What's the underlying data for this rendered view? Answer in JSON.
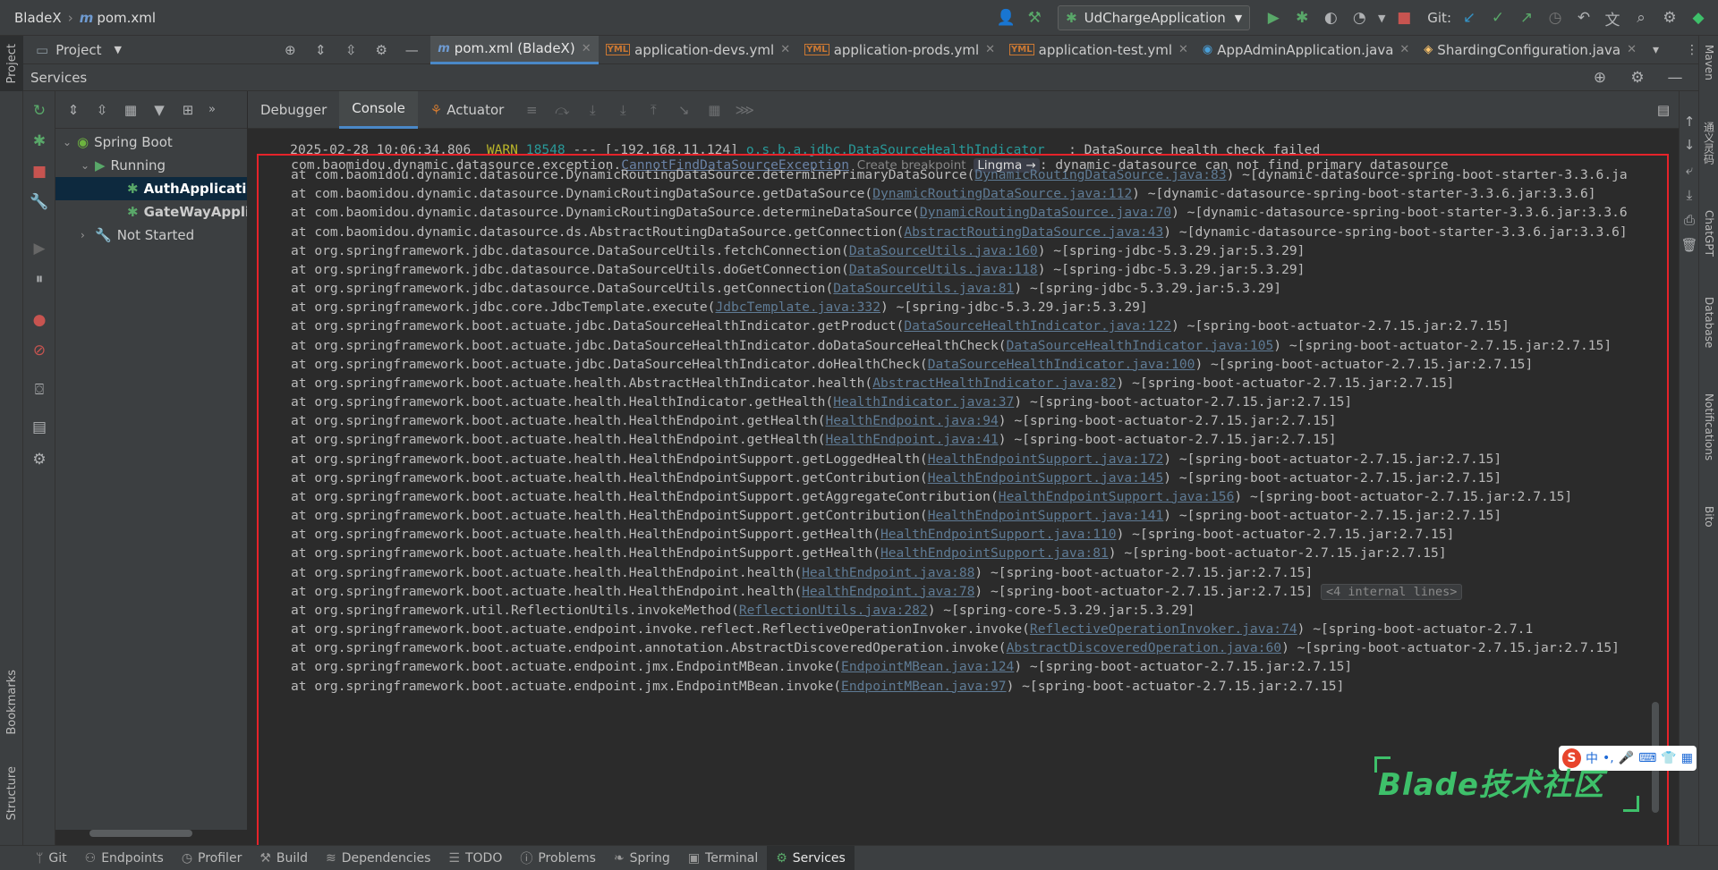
{
  "breadcrumb": {
    "project": "BladeX",
    "file": "pom.xml"
  },
  "toolbar": {
    "run_config": "UdChargeApplication",
    "git_label": "Git:"
  },
  "project_panel": {
    "label": "Project"
  },
  "editor_tabs": [
    {
      "label": "pom.xml (BladeX)",
      "icon": "m",
      "active": true
    },
    {
      "label": "application-devs.yml",
      "icon": "yml"
    },
    {
      "label": "application-prods.yml",
      "icon": "yml"
    },
    {
      "label": "application-test.yml",
      "icon": "yml"
    },
    {
      "label": "AppAdminApplication.java",
      "icon": "java"
    },
    {
      "label": "ShardingConfiguration.java",
      "icon": "java"
    }
  ],
  "services": {
    "title": "Services",
    "tree": {
      "root": "Spring Boot",
      "running": "Running",
      "apps": [
        "AuthApplication",
        "GateWayApplication"
      ],
      "not_started": "Not Started"
    },
    "console_tabs": [
      "Debugger",
      "Console",
      "Actuator"
    ]
  },
  "left_strip": {
    "project": "Project",
    "bookmarks": "Bookmarks",
    "structure": "Structure"
  },
  "right_strip": {
    "maven": "Maven",
    "tongyi": "通义灵码",
    "chatgpt": "ChatGPT",
    "database": "Database",
    "notifications": "Notifications",
    "bito": "Bito"
  },
  "console": {
    "warn_line": {
      "timestamp": "2025-02-28 10:06:34.806",
      "level": "WARN",
      "pid": "18548",
      "sep": "---",
      "thread": "[-192.168.11.124]",
      "logger": "o.s.b.a.jdbc.DataSourceHealthIndicator",
      "message": ": DataSource health check failed"
    },
    "exception": {
      "pkg": "com.baomidou.dynamic.datasource.exception.",
      "cls": "CannotFindDataSourceException",
      "hint": "Create breakpoint",
      "lingma": "Lingma →",
      "message": ": dynamic-datasource can not find primary datasource"
    },
    "frames": [
      {
        "method": "com.baomidou.dynamic.datasource.DynamicRoutingDataSource.determinePrimaryDataSource",
        "src": "DynamicRoutingDataSource.java:83",
        "jar": "~[dynamic-datasource-spring-boot-starter-3.3.6.ja"
      },
      {
        "method": "com.baomidou.dynamic.datasource.DynamicRoutingDataSource.getDataSource",
        "src": "DynamicRoutingDataSource.java:112",
        "jar": "~[dynamic-datasource-spring-boot-starter-3.3.6.jar:3.3.6]"
      },
      {
        "method": "com.baomidou.dynamic.datasource.DynamicRoutingDataSource.determineDataSource",
        "src": "DynamicRoutingDataSource.java:70",
        "jar": "~[dynamic-datasource-spring-boot-starter-3.3.6.jar:3.3.6"
      },
      {
        "method": "com.baomidou.dynamic.datasource.ds.AbstractRoutingDataSource.getConnection",
        "src": "AbstractRoutingDataSource.java:43",
        "jar": "~[dynamic-datasource-spring-boot-starter-3.3.6.jar:3.3.6]"
      },
      {
        "method": "org.springframework.jdbc.datasource.DataSourceUtils.fetchConnection",
        "src": "DataSourceUtils.java:160",
        "jar": "~[spring-jdbc-5.3.29.jar:5.3.29]"
      },
      {
        "method": "org.springframework.jdbc.datasource.DataSourceUtils.doGetConnection",
        "src": "DataSourceUtils.java:118",
        "jar": "~[spring-jdbc-5.3.29.jar:5.3.29]"
      },
      {
        "method": "org.springframework.jdbc.datasource.DataSourceUtils.getConnection",
        "src": "DataSourceUtils.java:81",
        "jar": "~[spring-jdbc-5.3.29.jar:5.3.29]"
      },
      {
        "method": "org.springframework.jdbc.core.JdbcTemplate.execute",
        "src": "JdbcTemplate.java:332",
        "jar": "~[spring-jdbc-5.3.29.jar:5.3.29]"
      },
      {
        "method": "org.springframework.boot.actuate.jdbc.DataSourceHealthIndicator.getProduct",
        "src": "DataSourceHealthIndicator.java:122",
        "jar": "~[spring-boot-actuator-2.7.15.jar:2.7.15]"
      },
      {
        "method": "org.springframework.boot.actuate.jdbc.DataSourceHealthIndicator.doDataSourceHealthCheck",
        "src": "DataSourceHealthIndicator.java:105",
        "jar": "~[spring-boot-actuator-2.7.15.jar:2.7.15]"
      },
      {
        "method": "org.springframework.boot.actuate.jdbc.DataSourceHealthIndicator.doHealthCheck",
        "src": "DataSourceHealthIndicator.java:100",
        "jar": "~[spring-boot-actuator-2.7.15.jar:2.7.15]"
      },
      {
        "method": "org.springframework.boot.actuate.health.AbstractHealthIndicator.health",
        "src": "AbstractHealthIndicator.java:82",
        "jar": "~[spring-boot-actuator-2.7.15.jar:2.7.15]"
      },
      {
        "method": "org.springframework.boot.actuate.health.HealthIndicator.getHealth",
        "src": "HealthIndicator.java:37",
        "jar": "~[spring-boot-actuator-2.7.15.jar:2.7.15]"
      },
      {
        "method": "org.springframework.boot.actuate.health.HealthEndpoint.getHealth",
        "src": "HealthEndpoint.java:94",
        "jar": "~[spring-boot-actuator-2.7.15.jar:2.7.15]"
      },
      {
        "method": "org.springframework.boot.actuate.health.HealthEndpoint.getHealth",
        "src": "HealthEndpoint.java:41",
        "jar": "~[spring-boot-actuator-2.7.15.jar:2.7.15]"
      },
      {
        "method": "org.springframework.boot.actuate.health.HealthEndpointSupport.getLoggedHealth",
        "src": "HealthEndpointSupport.java:172",
        "jar": "~[spring-boot-actuator-2.7.15.jar:2.7.15]"
      },
      {
        "method": "org.springframework.boot.actuate.health.HealthEndpointSupport.getContribution",
        "src": "HealthEndpointSupport.java:145",
        "jar": "~[spring-boot-actuator-2.7.15.jar:2.7.15]"
      },
      {
        "method": "org.springframework.boot.actuate.health.HealthEndpointSupport.getAggregateContribution",
        "src": "HealthEndpointSupport.java:156",
        "jar": "~[spring-boot-actuator-2.7.15.jar:2.7.15]"
      },
      {
        "method": "org.springframework.boot.actuate.health.HealthEndpointSupport.getContribution",
        "src": "HealthEndpointSupport.java:141",
        "jar": "~[spring-boot-actuator-2.7.15.jar:2.7.15]"
      },
      {
        "method": "org.springframework.boot.actuate.health.HealthEndpointSupport.getHealth",
        "src": "HealthEndpointSupport.java:110",
        "jar": "~[spring-boot-actuator-2.7.15.jar:2.7.15]"
      },
      {
        "method": "org.springframework.boot.actuate.health.HealthEndpointSupport.getHealth",
        "src": "HealthEndpointSupport.java:81",
        "jar": "~[spring-boot-actuator-2.7.15.jar:2.7.15]"
      },
      {
        "method": "org.springframework.boot.actuate.health.HealthEndpoint.health",
        "src": "HealthEndpoint.java:88",
        "jar": "~[spring-boot-actuator-2.7.15.jar:2.7.15]"
      },
      {
        "method": "org.springframework.boot.actuate.health.HealthEndpoint.health",
        "src": "HealthEndpoint.java:78",
        "jar": "~[spring-boot-actuator-2.7.15.jar:2.7.15]",
        "folded": "<4 internal lines>"
      },
      {
        "method": "org.springframework.util.ReflectionUtils.invokeMethod",
        "src": "ReflectionUtils.java:282",
        "jar": "~[spring-core-5.3.29.jar:5.3.29]"
      },
      {
        "method": "org.springframework.boot.actuate.endpoint.invoke.reflect.ReflectiveOperationInvoker.invoke",
        "src": "ReflectiveOperationInvoker.java:74",
        "jar": "~[spring-boot-actuator-2.7.1"
      },
      {
        "method": "org.springframework.boot.actuate.endpoint.annotation.AbstractDiscoveredOperation.invoke",
        "src": "AbstractDiscoveredOperation.java:60",
        "jar": "~[spring-boot-actuator-2.7.15.jar:2.7.15]"
      },
      {
        "method": "org.springframework.boot.actuate.endpoint.jmx.EndpointMBean.invoke",
        "src": "EndpointMBean.java:124",
        "jar": "~[spring-boot-actuator-2.7.15.jar:2.7.15]"
      },
      {
        "method": "org.springframework.boot.actuate.endpoint.jmx.EndpointMBean.invoke",
        "src": "EndpointMBean.java:97",
        "jar": "~[spring-boot-actuator-2.7.15.jar:2.7.15]"
      }
    ]
  },
  "watermark": "Blade技术社区",
  "ime": {
    "logo": "S",
    "lang": "中"
  },
  "statusbar": [
    {
      "label": "Git",
      "icon": "branch-icon"
    },
    {
      "label": "Endpoints",
      "icon": "endpoints-icon"
    },
    {
      "label": "Profiler",
      "icon": "profiler-icon"
    },
    {
      "label": "Build",
      "icon": "hammer-icon"
    },
    {
      "label": "Dependencies",
      "icon": "layers-icon"
    },
    {
      "label": "TODO",
      "icon": "list-icon"
    },
    {
      "label": "Problems",
      "icon": "info-icon"
    },
    {
      "label": "Spring",
      "icon": "leaf-icon"
    },
    {
      "label": "Terminal",
      "icon": "terminal-icon"
    },
    {
      "label": "Services",
      "icon": "services-icon",
      "active": true
    }
  ],
  "colors": {
    "accent": "#4a88c7",
    "highlight_box": "#e5232a",
    "warn": "#bbb529",
    "logger": "#299999",
    "watermark": "#3ec06a"
  }
}
